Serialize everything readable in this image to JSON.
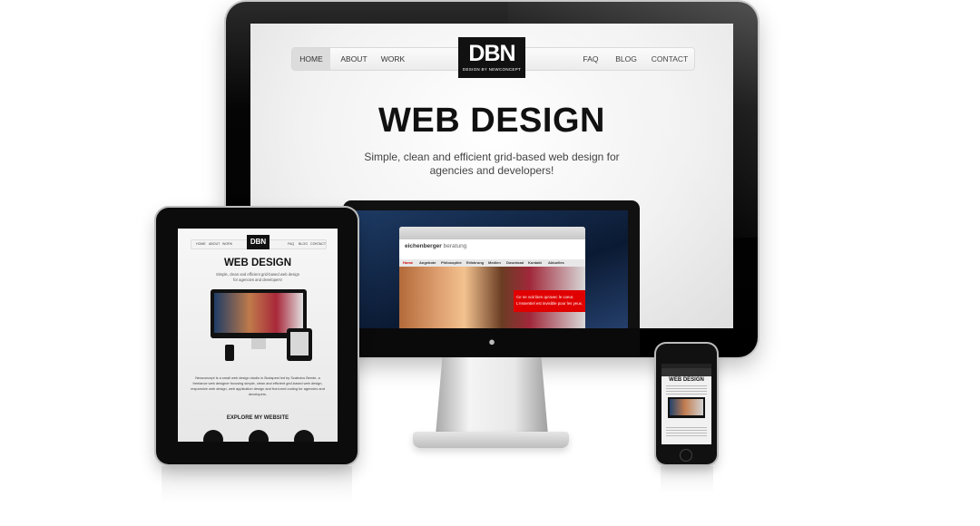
{
  "monitor": {
    "nav": {
      "left_items": [
        "HOME",
        "ABOUT",
        "WORK"
      ],
      "right_items": [
        "FAQ",
        "BLOG",
        "CONTACT"
      ],
      "active": "HOME"
    },
    "logo": {
      "text": "DBN",
      "tagline": "DESIGN BY NEWCONCEPT"
    },
    "hero_title": "WEB DESIGN",
    "hero_subtitle": "Simple, clean and efficient grid-based web design for agencies and developers!"
  },
  "mini_browser": {
    "brand_left": "eichenberger",
    "brand_right": "beratung",
    "menu": [
      "Home",
      "Angebote",
      "Philosophie",
      "Erfahrung",
      "Medien",
      "Download",
      "Kontakt",
      "Aktuelles"
    ],
    "red_box_text": "Ce ne voit bien qu'avec le coeur. L'essentiel est invisible pour les yeux."
  },
  "ipad": {
    "nav_items": [
      "HOME",
      "ABOUT",
      "WORK",
      "FAQ",
      "BLOG",
      "CONTACT"
    ],
    "logo": "DBN",
    "title": "WEB DESIGN",
    "subtitle": "Simple, clean and efficient grid-based web design for agencies and developers!",
    "body_text": "Newconcept is a small web design studio in Budapest led by Szabolcs Bende, a freelance web designer focusing simple, clean and efficient grid-based web design, responsive web design, web application design and front-end coding for agencies and developers.",
    "explore": "EXPLORE MY WEBSITE"
  },
  "iphone": {
    "title": "WEB DESIGN"
  },
  "icons": {
    "apple": "apple-logo-icon"
  }
}
